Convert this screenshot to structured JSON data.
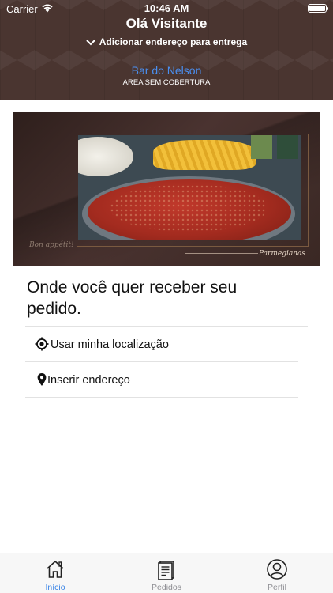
{
  "status_bar": {
    "carrier": "Carrier",
    "time": "10:46 AM",
    "icons": [
      "wifi-icon",
      "battery-icon"
    ]
  },
  "header": {
    "greeting": "Olá Visitante",
    "address_action": "Adicionar endereço para entrega",
    "store_name": "Bar do Nelson",
    "coverage_status": "AREA SEM COBERTURA",
    "background_color": "#4a3530",
    "store_name_color": "#4a8ff0"
  },
  "banner": {
    "script_left": "Bon appétit!",
    "script_right": "Parmegianas"
  },
  "delivery": {
    "question": "Onde você quer receber seu pedido.",
    "options": [
      {
        "label": "Usar minha localização",
        "icon": "location-target-icon"
      },
      {
        "label": "Inserir endereço",
        "icon": "map-pin-icon"
      }
    ]
  },
  "tabbar": {
    "active_color": "#3a84e6",
    "tabs": [
      {
        "label": "Início",
        "icon": "home-icon",
        "active": true
      },
      {
        "label": "Pedidos",
        "icon": "orders-icon",
        "active": false
      },
      {
        "label": "Perfil",
        "icon": "profile-icon",
        "active": false
      }
    ]
  }
}
